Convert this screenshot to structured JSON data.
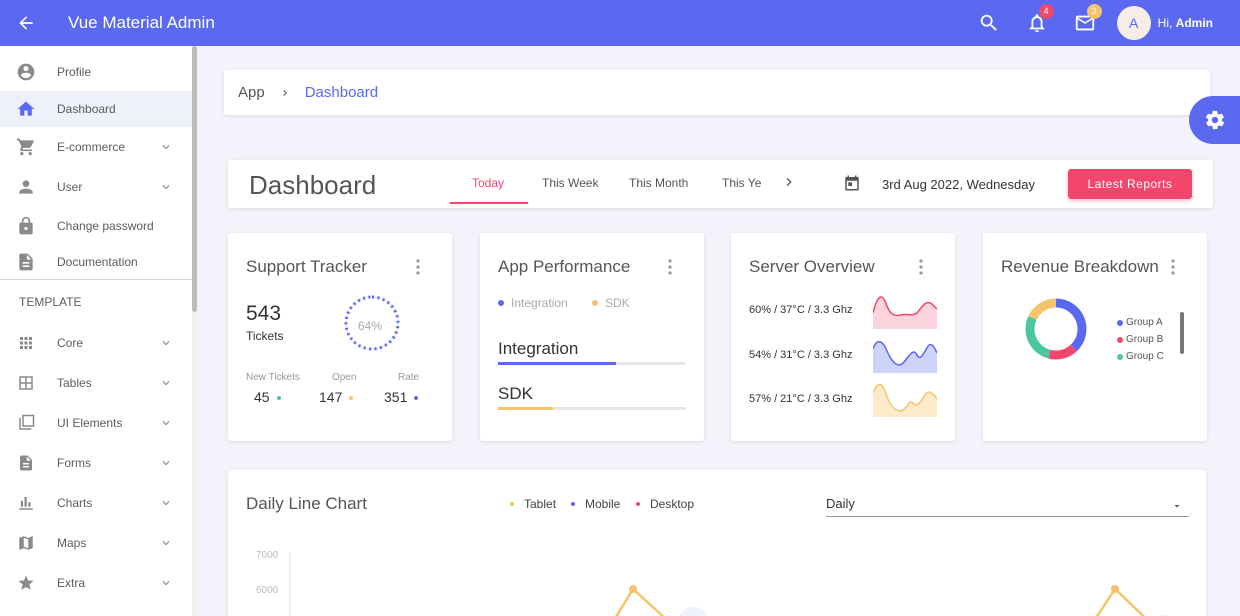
{
  "app": {
    "title": "Vue Material Admin"
  },
  "topbar": {
    "notifications_count": "4",
    "messages_count": "3",
    "avatar_initial": "A",
    "greeting_prefix": "Hi, ",
    "greeting_name": "Admin"
  },
  "sidebar": {
    "items": [
      {
        "label": "Profile",
        "icon": "account-circle-icon"
      },
      {
        "label": "Dashboard",
        "icon": "home-icon",
        "active": true
      },
      {
        "label": "E-commerce",
        "icon": "cart-icon",
        "expandable": true
      },
      {
        "label": "User",
        "icon": "person-icon",
        "expandable": true
      },
      {
        "label": "Change password",
        "icon": "lock-icon"
      },
      {
        "label": "Documentation",
        "icon": "document-icon"
      }
    ],
    "section_label": "TEMPLATE",
    "template_items": [
      {
        "label": "Core",
        "icon": "grid-icon"
      },
      {
        "label": "Tables",
        "icon": "table-icon"
      },
      {
        "label": "UI Elements",
        "icon": "layers-icon"
      },
      {
        "label": "Forms",
        "icon": "form-icon"
      },
      {
        "label": "Charts",
        "icon": "bar-chart-icon"
      },
      {
        "label": "Maps",
        "icon": "map-icon"
      },
      {
        "label": "Extra",
        "icon": "star-icon"
      }
    ]
  },
  "breadcrumb": {
    "root": "App",
    "current": "Dashboard"
  },
  "dashboard": {
    "title": "Dashboard",
    "tabs": [
      "Today",
      "This Week",
      "This Month",
      "This Ye"
    ],
    "active_tab": "Today",
    "date": "3rd Aug 2022, Wednesday",
    "report_button": "Latest Reports"
  },
  "support_tracker": {
    "title": "Support Tracker",
    "tickets": "543",
    "tickets_label": "Tickets",
    "percent": 0.64,
    "percent_label": "64%",
    "stats": [
      {
        "label": "New Tickets",
        "value": "45",
        "color": "#4cc79b"
      },
      {
        "label": "Open",
        "value": "147",
        "color": "#f4c36c"
      },
      {
        "label": "Rate",
        "value": "351",
        "color": "#5a69f0"
      }
    ]
  },
  "app_performance": {
    "title": "App Performance",
    "legend": [
      {
        "label": "Integration",
        "color": "#5a69f0"
      },
      {
        "label": "SDK",
        "color": "#f4c36c"
      }
    ],
    "bars": [
      {
        "label": "Integration",
        "value": 0.63,
        "color": "#5a69f0"
      },
      {
        "label": "SDK",
        "value": 0.29,
        "color": "#f4c36c"
      }
    ]
  },
  "server_overview": {
    "title": "Server Overview",
    "rows": [
      {
        "label": "60% / 37°C / 3.3 Ghz",
        "color": "#f2466c",
        "fill": "#fbd3dd"
      },
      {
        "label": "54% / 31°C / 3.3 Ghz",
        "color": "#5a69f0",
        "fill": "#cdd2f7"
      },
      {
        "label": "57% / 21°C / 3.3 Ghz",
        "color": "#f4c36c",
        "fill": "#fcebcb"
      }
    ]
  },
  "revenue": {
    "title": "Revenue Breakdown",
    "groups": [
      {
        "label": "Group A",
        "color": "#5a69f0",
        "share": 0.38
      },
      {
        "label": "Group B",
        "color": "#f2466c",
        "share": 0.16
      },
      {
        "label": "Group C",
        "color": "#4cc79b",
        "share": 0.28
      },
      {
        "label": "",
        "color": "#f4c36c",
        "share": 0.18
      }
    ]
  },
  "daily_chart": {
    "title": "Daily Line Chart",
    "legend": [
      {
        "label": "Tablet",
        "color": "#f4c36c"
      },
      {
        "label": "Mobile",
        "color": "#5a69f0"
      },
      {
        "label": "Desktop",
        "color": "#f2466c"
      }
    ],
    "select_value": "Daily",
    "y_ticks": [
      "7000",
      "6000"
    ]
  },
  "colors": {
    "primary": "#5a69f0",
    "accent": "#f2466c",
    "yellow": "#f4c36c",
    "green": "#4cc79b"
  }
}
